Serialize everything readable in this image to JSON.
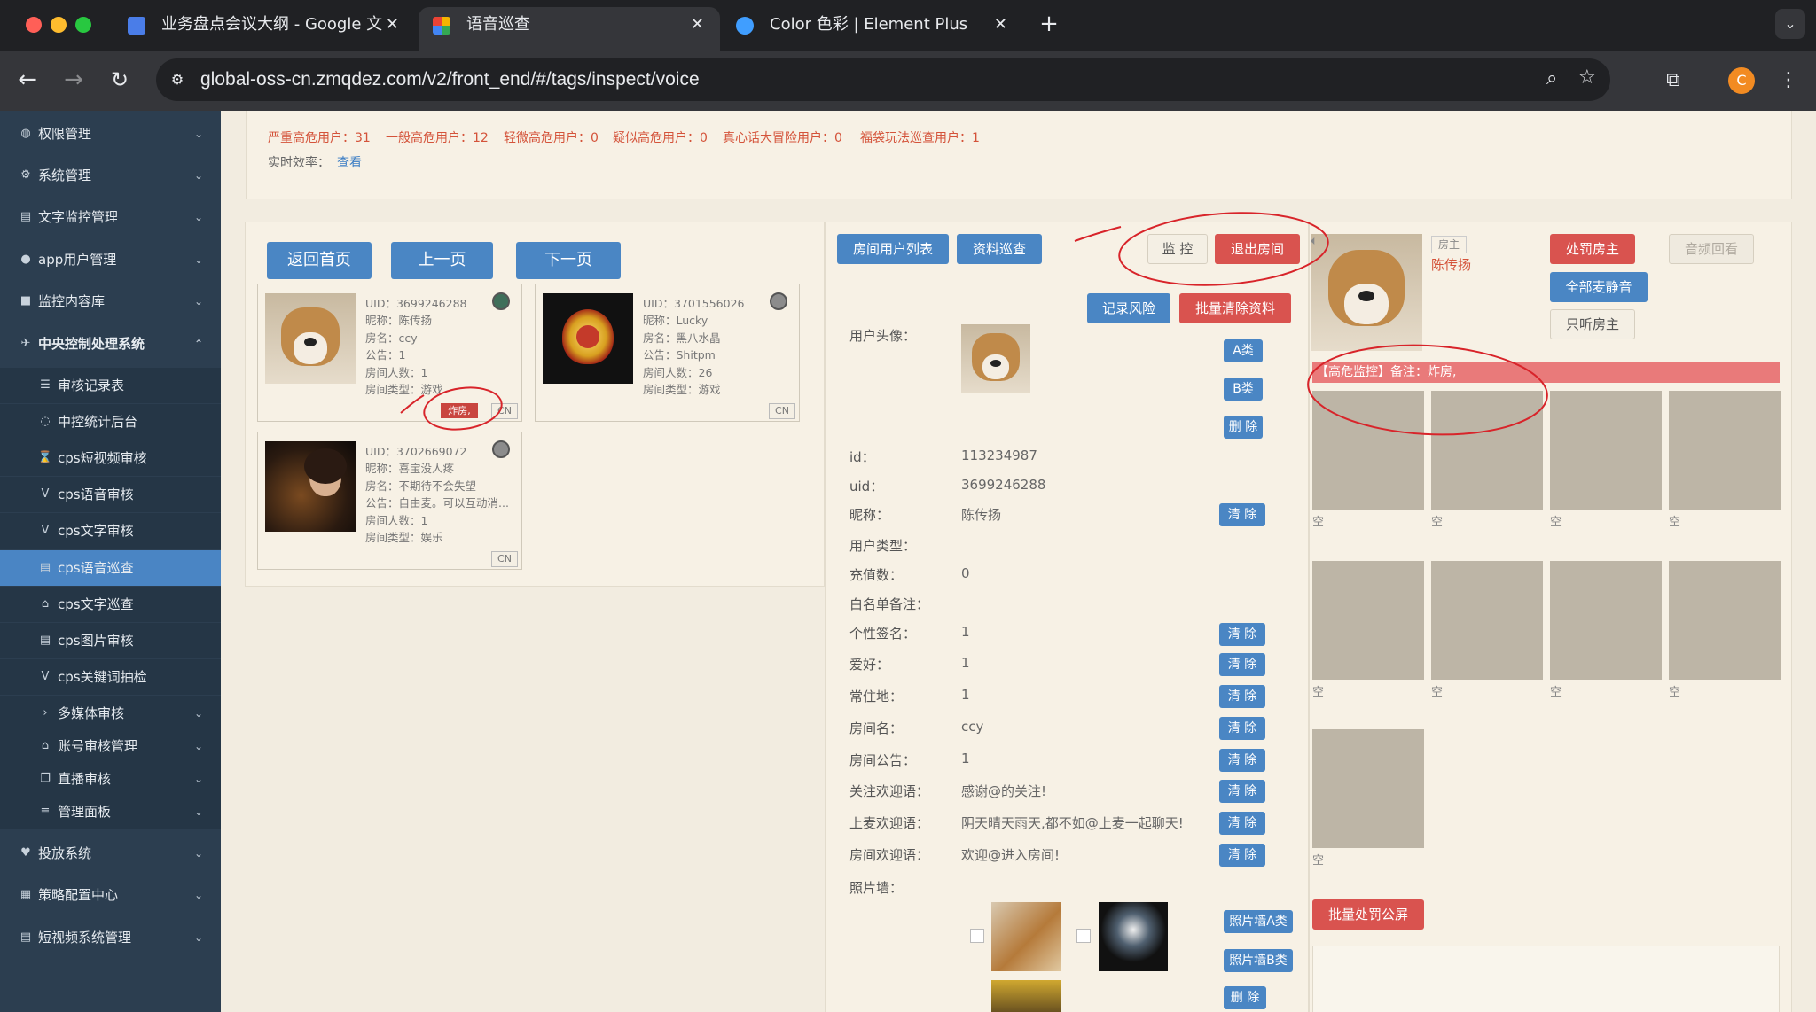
{
  "browser": {
    "tabs": [
      {
        "title": "业务盘点会议大纲 - Google 文",
        "favicon": "google-docs-icon"
      },
      {
        "title": "语音巡查",
        "favicon": "app-icon"
      },
      {
        "title": "Color 色彩 | Element Plus",
        "favicon": "element-plus-icon"
      }
    ],
    "url": "global-oss-cn.zmqdez.com/v2/front_end/#/tags/inspect/voice",
    "profile_initial": "C"
  },
  "sidebar": {
    "items": [
      {
        "label": "权限管理",
        "icon": "permission-icon"
      },
      {
        "label": "系统管理",
        "icon": "gear-icon"
      },
      {
        "label": "文字监控管理",
        "icon": "document-icon"
      },
      {
        "label": "app用户管理",
        "icon": "user-icon"
      },
      {
        "label": "监控内容库",
        "icon": "box-icon"
      },
      {
        "label": "中央控制处理系统",
        "icon": "plane-icon"
      }
    ],
    "sub_items": [
      {
        "label": "审核记录表",
        "icon": "list-icon"
      },
      {
        "label": "中控统计后台",
        "icon": "chat-icon"
      },
      {
        "label": "cps短视频审核",
        "icon": "hourglass-icon"
      },
      {
        "label": "cps语音审核",
        "icon": "v-icon"
      },
      {
        "label": "cps文字审核",
        "icon": "v-icon"
      },
      {
        "label": "cps语音巡查",
        "icon": "document-icon"
      },
      {
        "label": "cps文字巡查",
        "icon": "home-icon"
      },
      {
        "label": "cps图片审核",
        "icon": "document-icon"
      },
      {
        "label": "cps关键词抽检",
        "icon": "v-icon"
      },
      {
        "label": "多媒体审核",
        "icon": "chevron-right-icon"
      },
      {
        "label": "账号审核管理",
        "icon": "bank-icon"
      },
      {
        "label": "直播审核",
        "icon": "copy-icon"
      },
      {
        "label": "管理面板",
        "icon": "menu-icon"
      }
    ],
    "bottom_items": [
      {
        "label": "投放系统",
        "icon": "heart-icon"
      },
      {
        "label": "策略配置中心",
        "icon": "calendar-icon"
      },
      {
        "label": "短视频系统管理",
        "icon": "document-icon"
      }
    ]
  },
  "stats": {
    "items": [
      "严重高危用户：31",
      "一般高危用户：12",
      "轻微高危用户：0",
      "疑似高危用户：0",
      "真心话大冒险用户：0",
      "福袋玩法巡查用户：1"
    ],
    "efficiency_label": "实时效率：",
    "efficiency_link": "查看"
  },
  "nav_buttons": {
    "home": "返回首页",
    "prev": "上一页",
    "next": "下一页"
  },
  "rooms": [
    {
      "uid": "UID：3699246288",
      "nickname": "昵称：陈传扬",
      "room_name": "房名：ccy",
      "notice": "公告：1",
      "members": "房间人数：1",
      "type": "房间类型：游戏",
      "tag": "炸房,",
      "region": "CN"
    },
    {
      "uid": "UID：3701556026",
      "nickname": "昵称：Lucky",
      "room_name": "房名：黑八水晶",
      "notice": "公告：Shitpm",
      "members": "房间人数：26",
      "type": "房间类型：游戏",
      "region": "CN"
    },
    {
      "uid": "UID：3702669072",
      "nickname": "昵称：喜宝没人疼",
      "room_name": "房名：不期待不会失望",
      "notice": "公告：自由麦。可以互动消...",
      "members": "房间人数：1",
      "type": "房间类型：娱乐",
      "region": "CN"
    }
  ],
  "detail": {
    "top_buttons": {
      "room_users": "房间用户列表",
      "profile_check": "资料巡查",
      "monitor": "监 控",
      "exit_room": "退出房间"
    },
    "risk_buttons": {
      "record_risk": "记录风险",
      "batch_clear": "批量清除资料"
    },
    "class_buttons": {
      "class_a": "A类",
      "class_b": "B类",
      "delete": "删 除"
    },
    "avatar_label": "用户头像：",
    "fields": [
      {
        "label": "id：",
        "value": "113234987"
      },
      {
        "label": "uid：",
        "value": "3699246288"
      },
      {
        "label": "昵称：",
        "value": "陈传扬",
        "clear": "清 除"
      },
      {
        "label": "用户类型：",
        "value": ""
      },
      {
        "label": "充值数：",
        "value": "0"
      },
      {
        "label": "白名单备注：",
        "value": ""
      },
      {
        "label": "个性签名：",
        "value": "1",
        "clear": "清 除"
      },
      {
        "label": "爱好：",
        "value": "1",
        "clear": "清 除"
      },
      {
        "label": "常住地：",
        "value": "1",
        "clear": "清 除"
      },
      {
        "label": "房间名：",
        "value": "ccy",
        "clear": "清 除"
      },
      {
        "label": "房间公告：",
        "value": "1",
        "clear": "清 除"
      },
      {
        "label": "关注欢迎语：",
        "value": "感谢@的关注!",
        "clear": "清 除"
      },
      {
        "label": "上麦欢迎语：",
        "value": "阴天晴天雨天,都不如@上麦一起聊天!",
        "clear": "清 除"
      },
      {
        "label": "房间欢迎语：",
        "value": "欢迎@进入房间!",
        "clear": "清 除"
      }
    ],
    "photo_wall_label": "照片墙：",
    "photo_buttons": {
      "wall_a": "照片墙A类",
      "wall_b": "照片墙B类",
      "delete": "删 除"
    }
  },
  "host_panel": {
    "host_tag": "房主",
    "host_name": "陈传扬",
    "punish_host": "处罚房主",
    "audio_playback": "音频回看",
    "mute_all": "全部麦静音",
    "listen_host": "只听房主",
    "alert": "【高危监控】备注：炸房,",
    "empty_label": "空",
    "batch_punish": "批量处罚公屏"
  },
  "colors": {
    "accent_blue": "#4a86c4",
    "danger_red": "#d9534f",
    "sidebar_bg": "#2c3e50",
    "annotation_red": "#d8242a"
  }
}
